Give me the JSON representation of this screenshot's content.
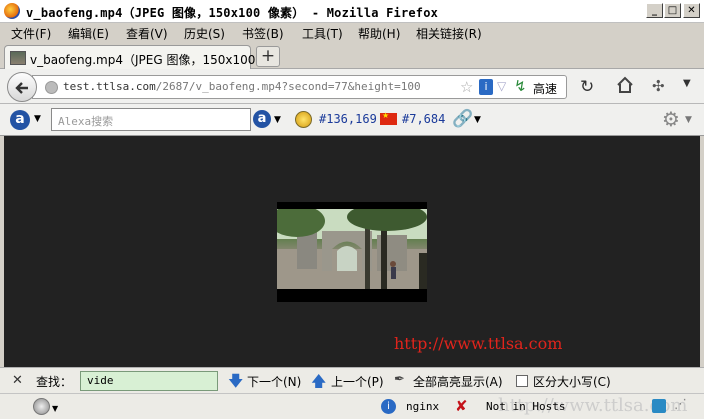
{
  "window": {
    "title": "v_baofeng.mp4（JPEG 图像，150x100 像素） - Mozilla Firefox",
    "controls": [
      "_",
      "□",
      "✕"
    ]
  },
  "menu": [
    "文件(F)",
    "编辑(E)",
    "查看(V)",
    "历史(S)",
    "书签(B)",
    "工具(T)",
    "帮助(H)",
    "相关链接(R)"
  ],
  "tab": {
    "label": "v_baofeng.mp4（JPEG 图像，150x100 …",
    "new_tab": "+"
  },
  "nav": {
    "url_host": "test.ttlsa.com",
    "url_path": "/2687/v_baofeng.mp4?second=77&height=100",
    "speed_label": "高速"
  },
  "alexa": {
    "logo": "a",
    "placeholder": "Alexa搜索",
    "rank_global": "#136,169",
    "rank_country": "#7,684"
  },
  "content": {
    "watermark": "http://www.ttlsa.com"
  },
  "findbar": {
    "close": "✕",
    "label": "查找：",
    "value": "vide",
    "next": "下一个(N)",
    "prev": "上一个(P)",
    "highlight": "全部高亮显示(A)",
    "match_case": "区分大小写(C)"
  },
  "status": {
    "server": "nginx",
    "hosts": "Not in Hosts",
    "watermark": "http://www.ttlsa.com"
  },
  "colors": {
    "watermark": "#e0241c",
    "content_bg": "#222222",
    "find_input_bg": "#d8f0d4"
  }
}
